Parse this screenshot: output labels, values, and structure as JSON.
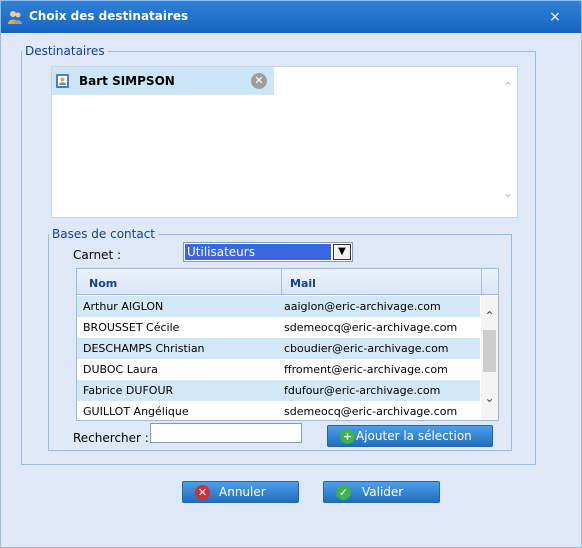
{
  "window": {
    "title": "Choix des destinataires",
    "close_glyph": "×"
  },
  "destinataires": {
    "legend": "Destinataires",
    "recipients": [
      {
        "name": "Bart SIMPSON",
        "icon": "contact-card-icon"
      }
    ]
  },
  "bases": {
    "legend": "Bases de contact",
    "carnet_label": "Carnet :",
    "carnet_value": "Utilisateurs",
    "columns": [
      "Nom",
      "Mail"
    ],
    "rows": [
      {
        "nom": "Arthur AIGLON",
        "mail": "aaiglon@eric-archivage.com"
      },
      {
        "nom": "BROUSSET Cécile",
        "mail": "sdemeocq@eric-archivage.com"
      },
      {
        "nom": "DESCHAMPS Christian",
        "mail": "cboudier@eric-archivage.com"
      },
      {
        "nom": "DUBOC Laura",
        "mail": "ffroment@eric-archivage.com"
      },
      {
        "nom": "Fabrice DUFOUR",
        "mail": "fdufour@eric-archivage.com"
      },
      {
        "nom": "GUILLOT Angélique",
        "mail": "sdemeocq@eric-archivage.com"
      }
    ],
    "search_label": "Rechercher :",
    "search_value": "",
    "add_label": "Ajouter la sélection"
  },
  "footer": {
    "cancel_label": "Annuler",
    "ok_label": "Valider"
  },
  "colors": {
    "titlebar": "#1e6fc8",
    "row_alt": "#d3e8f6",
    "chip": "#cde6f7",
    "button": "#2a7dd0"
  }
}
